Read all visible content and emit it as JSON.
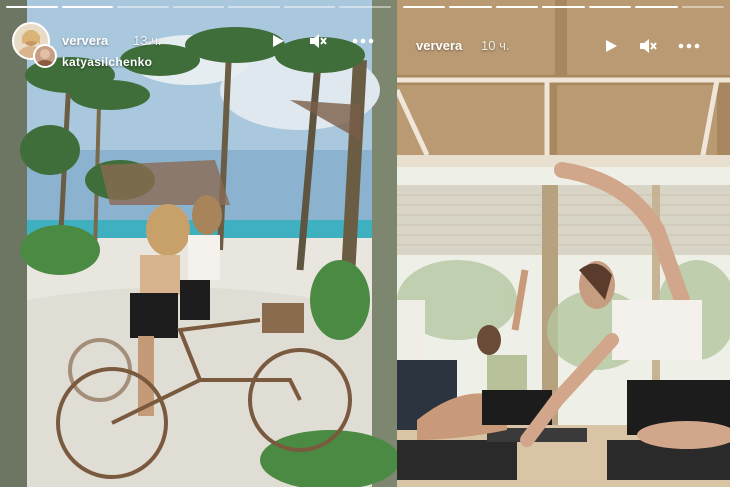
{
  "stories": {
    "left": {
      "username": "ververa",
      "time": "13 ч.",
      "mention": "katyasilchenko",
      "progress": [
        1,
        1,
        0,
        0,
        0,
        0,
        0
      ],
      "controls": {
        "play_icon": "play-icon",
        "mute_icon": "mute-icon",
        "more_icon": "more-icon"
      }
    },
    "right": {
      "username": "ververa",
      "time": "10 ч.",
      "progress": [
        1,
        1,
        1,
        1,
        1,
        1,
        0
      ],
      "controls": {
        "play_icon": "play-icon",
        "mute_icon": "mute-icon",
        "more_icon": "more-icon"
      }
    }
  }
}
